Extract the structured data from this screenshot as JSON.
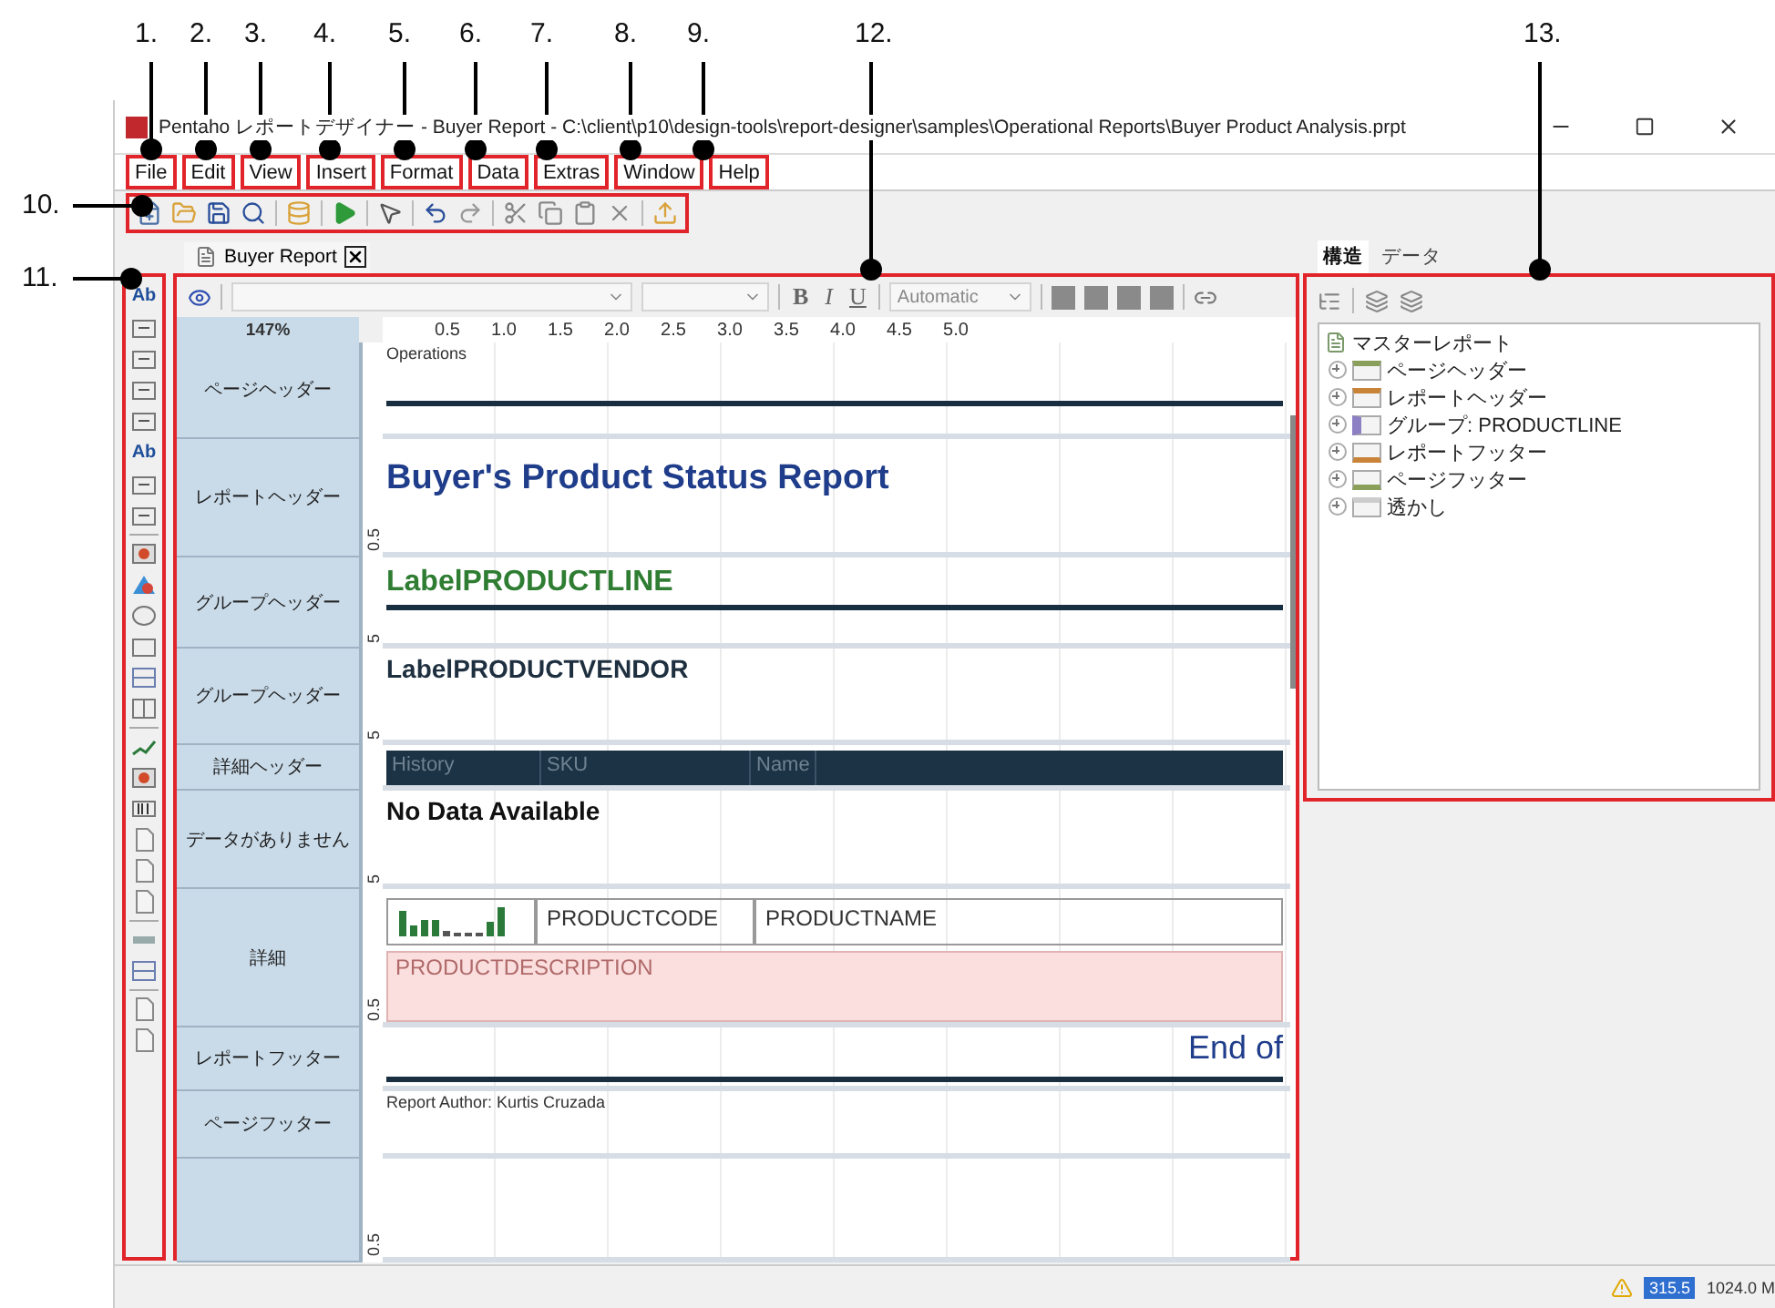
{
  "callouts": [
    {
      "number": "1."
    },
    {
      "number": "2."
    },
    {
      "number": "3."
    },
    {
      "number": "4."
    },
    {
      "number": "5."
    },
    {
      "number": "6."
    },
    {
      "number": "7."
    },
    {
      "number": "8."
    },
    {
      "number": "9."
    },
    {
      "number": "10."
    },
    {
      "number": "11."
    },
    {
      "number": "12."
    },
    {
      "number": "13."
    }
  ],
  "window": {
    "title": "Pentaho レポートデザイナー - Buyer Report - C:\\client\\p10\\design-tools\\report-designer\\samples\\Operational Reports\\Buyer Product Analysis.prpt"
  },
  "menu": [
    {
      "label": "File"
    },
    {
      "label": "Edit"
    },
    {
      "label": "View"
    },
    {
      "label": "Insert"
    },
    {
      "label": "Format"
    },
    {
      "label": "Data"
    },
    {
      "label": "Extras"
    },
    {
      "label": "Window"
    },
    {
      "label": "Help"
    }
  ],
  "doc_tab": {
    "label": "Buyer Report"
  },
  "palette": [
    {
      "kind": "text",
      "text": "Ab"
    },
    {
      "kind": "tag"
    },
    {
      "kind": "tag"
    },
    {
      "kind": "tag"
    },
    {
      "kind": "tag"
    },
    {
      "kind": "text",
      "text": "Ab"
    },
    {
      "kind": "tag"
    },
    {
      "kind": "tag"
    },
    {
      "kind": "sep"
    },
    {
      "kind": "image"
    },
    {
      "kind": "shapes"
    },
    {
      "kind": "ellipse"
    },
    {
      "kind": "rect"
    },
    {
      "kind": "band"
    },
    {
      "kind": "split"
    },
    {
      "kind": "sep"
    },
    {
      "kind": "spark"
    },
    {
      "kind": "image"
    },
    {
      "kind": "barcode"
    },
    {
      "kind": "doc"
    },
    {
      "kind": "doc"
    },
    {
      "kind": "doc"
    },
    {
      "kind": "sep"
    },
    {
      "kind": "line"
    },
    {
      "kind": "band"
    },
    {
      "kind": "sep"
    },
    {
      "kind": "doc"
    },
    {
      "kind": "doc"
    }
  ],
  "format_bar": {
    "bold": "B",
    "italic": "I",
    "underline": "U",
    "color_mode": "Automatic"
  },
  "ruler": {
    "zoom": "147%",
    "ticks": [
      "0.5",
      "1.0",
      "1.5",
      "2.0",
      "2.5",
      "3.0",
      "3.5",
      "4.0",
      "4.5",
      "5.0"
    ]
  },
  "sections": [
    {
      "label": "ページヘッダー",
      "kind": "small",
      "text": "Operations",
      "rule": true
    },
    {
      "label": "レポートヘッダー",
      "kind": "title",
      "text": "Buyer's Product Status Report",
      "ruler_mark": "0.5",
      "rule": false
    },
    {
      "label": "グループヘッダー",
      "kind": "group",
      "text": "LabelPRODUCTLINE",
      "color": "#2e7d32",
      "ruler_mark": "5",
      "rule": true
    },
    {
      "label": "グループヘッダー",
      "kind": "group",
      "text": "LabelPRODUCTVENDOR",
      "color": "#1e2f3f",
      "ruler_mark": "5",
      "rule": false
    },
    {
      "label": "詳細ヘッダー",
      "kind": "header-row",
      "columns": [
        "History",
        "SKU",
        "Name"
      ]
    },
    {
      "label": "データがありません",
      "kind": "group",
      "text": "No Data Available",
      "color": "#111111",
      "ruler_mark": "5",
      "rule": false
    },
    {
      "label": "詳細",
      "kind": "detail",
      "fields": [
        "PRODUCTCODE",
        "PRODUCTNAME"
      ],
      "description": "PRODUCTDESCRIPTION",
      "ruler_mark": "0.5"
    },
    {
      "label": "レポートフッター",
      "kind": "end",
      "text": "End of",
      "rule": true
    },
    {
      "label": "ページフッター",
      "kind": "small",
      "text": "Report Author:  Kurtis Cruzada",
      "rule": false
    },
    {
      "kind": "empty",
      "ruler_mark": "0.5"
    }
  ],
  "panel": {
    "tabs": [
      {
        "label": "構造",
        "selected": true
      },
      {
        "label": "データ",
        "selected": false
      }
    ],
    "tree": {
      "label": "マスターレポート",
      "children": [
        {
          "label": "ページヘッダー",
          "kind": "header",
          "color": "#8aa05a",
          "expanded": false
        },
        {
          "label": "レポートヘッダー",
          "kind": "header",
          "color": "#c9843a",
          "expanded": false
        },
        {
          "label": "グループ: PRODUCTLINE",
          "kind": "group",
          "color": "#8c7fc4",
          "expanded": false
        },
        {
          "label": "レポートフッター",
          "kind": "footer",
          "color": "#c9843a",
          "expanded": false
        },
        {
          "label": "ページフッター",
          "kind": "footer",
          "color": "#8aa05a",
          "expanded": false
        },
        {
          "label": "透かし",
          "kind": "plain",
          "color": "#cccccc",
          "expanded": false
        }
      ]
    }
  },
  "status": {
    "memory_used": "315.5",
    "memory_total": "1024.0 M"
  }
}
